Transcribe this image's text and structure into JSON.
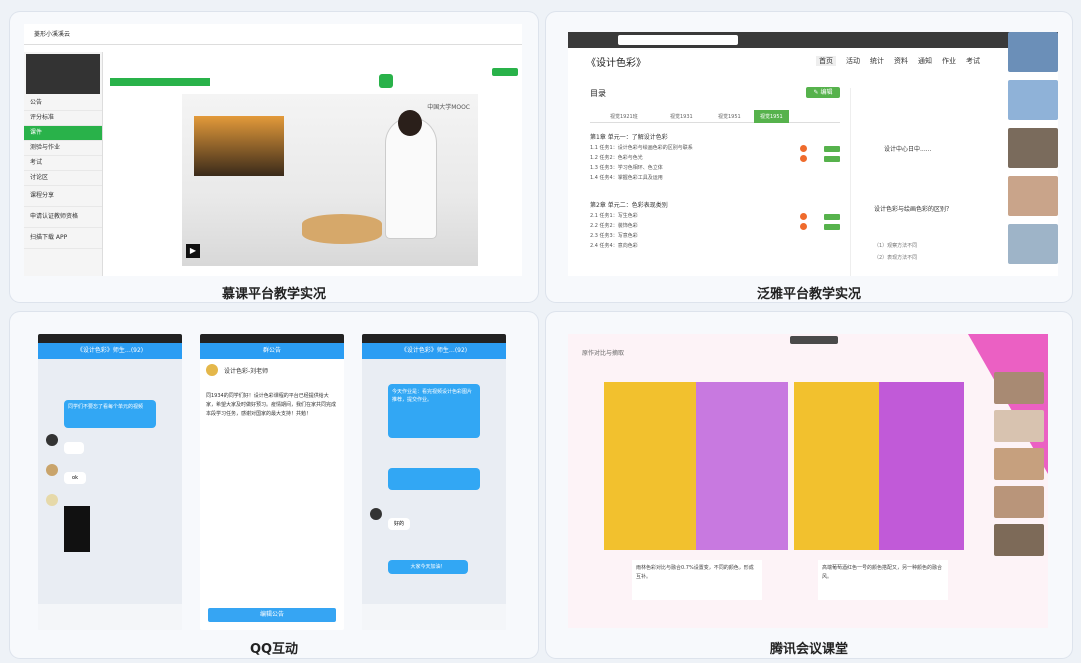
{
  "captions": {
    "mooc": "慕课平台教学实况",
    "fanya": "泛雅平台教学实况",
    "qq": "QQ互动",
    "tencent": "腾讯会议课堂"
  },
  "mooc": {
    "logo_text": "菱形小溪溪云",
    "sidebar_items": [
      "公告",
      "评分标准",
      "课件",
      "测验与作业",
      "考试",
      "讨论区"
    ],
    "share_label": "课程分享",
    "app_label_1": "申请认证教师资格",
    "app_label_2": "扫描下载 APP",
    "watermark": "中国大学MOOC"
  },
  "fanya": {
    "course_title": "《设计色彩》",
    "nav": [
      "首页",
      "活动",
      "统计",
      "资料",
      "通知",
      "作业",
      "考试"
    ],
    "toc_title": "目录",
    "toc_button": "✎ 编辑",
    "tabs": [
      "视觉1921班",
      "视觉1931",
      "视觉1951",
      "视觉1951"
    ],
    "units": [
      {
        "title": "第1章 单元一：了解设计色彩",
        "items": [
          "1.1 任务1：设计色彩与绘画色彩的区别与联系",
          "1.2 任务2：色彩与色光",
          "1.3 任务3：学习色相环、色立体",
          "1.4 任务4：掌握色彩工具及运用"
        ]
      },
      {
        "title": "第2章 单元二：色彩表现类别",
        "items": [
          "2.1 任务1：写生色彩",
          "2.2 任务2：装饰色彩",
          "2.3 任务3：写意色彩",
          "2.4 任务4：意向色彩"
        ]
      }
    ],
    "post_title": "设计色彩与绘画色彩的区别？",
    "post_options": [
      "（1）观察方法不同",
      "（2）表现方法不同"
    ],
    "notice": "设计中心日中......"
  },
  "qq": {
    "chat_title": "《设计色彩》师生…(92)",
    "notice_title": "群公告",
    "notice_author": "设计色彩-刘老师",
    "notice_body": "同1934的同学们好！设计色彩课程的平台已经提供给大家，希望大家及时做好预习。疫情期间，我们在家共同完成本段学习任务，感谢对国家的最大支持！共勉！",
    "notice_button": "编辑公告",
    "bubble_1": "同学们不要忘了看每个单元的视频",
    "reply_1": "ok",
    "bubble_right": "今天作业是：看完视频设计色彩图片推荐，提交作业。",
    "reply_2": "好的",
    "bubble_3": "大家今天加油！"
  },
  "tencent": {
    "slide_title": "原作对比与摘取",
    "caption_left": "雨林色彩对比与融合0.7%设置变，不同的颜色，形成互补。",
    "caption_right": "高端葡萄酒红色一号的颜色搭配又，另一种颜色的融合风。"
  },
  "colors": {
    "green": "#29b24a",
    "blue": "#2b9df3",
    "pink": "#e63bb5",
    "yellow": "#f2c12e"
  }
}
